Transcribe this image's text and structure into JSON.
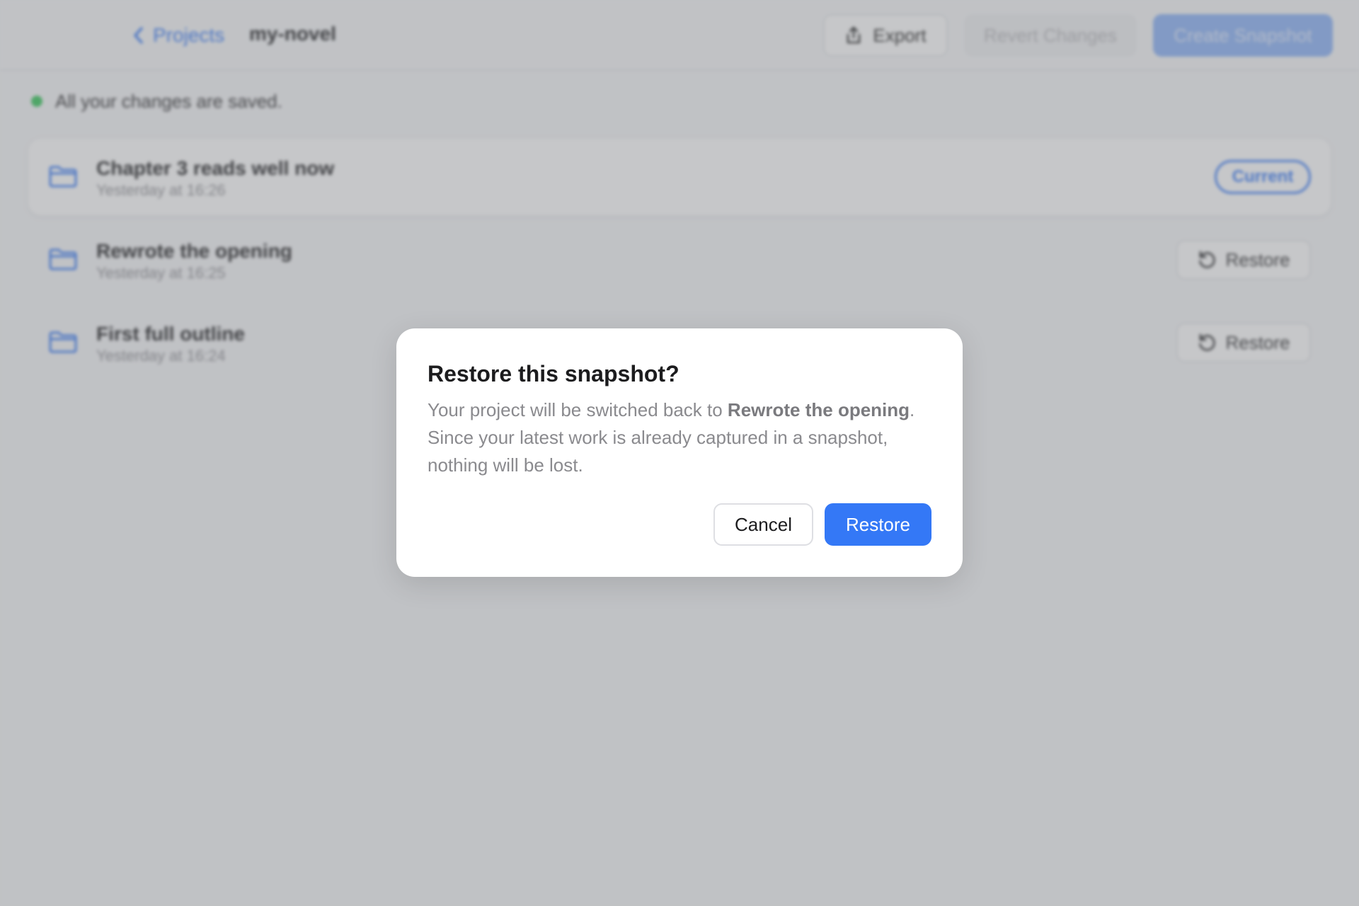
{
  "header": {
    "back_label": "Projects",
    "project_name": "my-novel",
    "export_label": "Export",
    "revert_label": "Revert Changes",
    "create_snapshot_label": "Create Snapshot"
  },
  "status": {
    "saved_text": "All your changes are saved.",
    "color": "#34c759"
  },
  "snapshots": [
    {
      "title": "Chapter 3 reads well now",
      "time": "Yesterday at 16:26",
      "badge": "Current"
    },
    {
      "title": "Rewrote the opening",
      "time": "Yesterday at 16:25",
      "action": "Restore"
    },
    {
      "title": "First full outline",
      "time": "Yesterday at 16:24",
      "action": "Restore"
    }
  ],
  "dialog": {
    "title": "Restore this snapshot?",
    "body_prefix": "Your project will be switched back to ",
    "body_snapshot_name": "Rewrote the opening",
    "body_suffix": ". Since your latest work is already captured in a snapshot, nothing will be lost.",
    "cancel_label": "Cancel",
    "confirm_label": "Restore"
  },
  "colors": {
    "accent": "#3478f6",
    "overlay": "rgba(120,121,126,0.42)"
  },
  "icons": {
    "back": "chevron-left-icon",
    "export": "share-upload-icon",
    "folder": "folder-icon",
    "restore": "restore-arrow-icon"
  }
}
